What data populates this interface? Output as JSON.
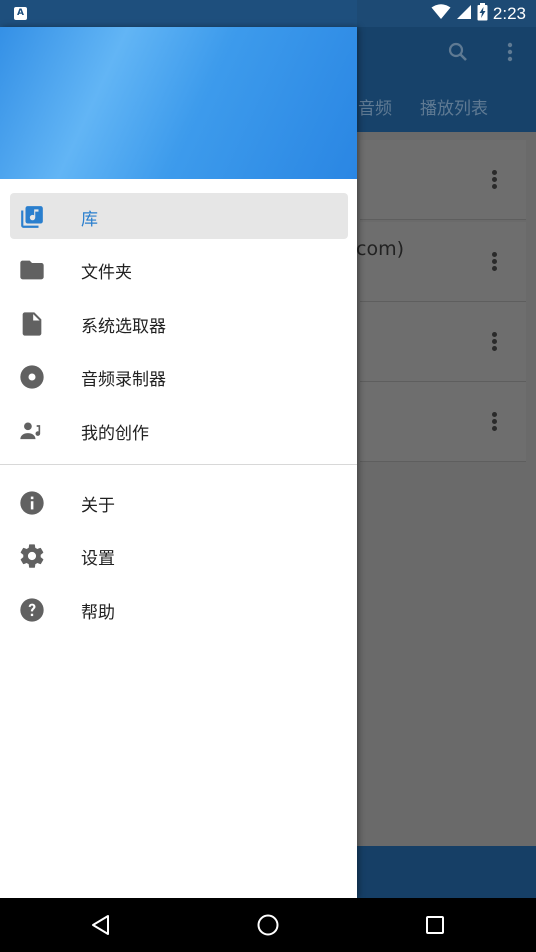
{
  "status_bar": {
    "notification_icon_letter": "A",
    "time": "2:23",
    "icons": [
      "wifi-icon",
      "signal-icon",
      "battery-charging-icon"
    ]
  },
  "background_app": {
    "tabs": [
      "音频",
      "播放列表"
    ],
    "actions": [
      "search-icon",
      "more-vert-icon"
    ],
    "visible_fragment": "com)"
  },
  "drawer": {
    "primary_items": [
      {
        "label": "库",
        "icon": "library-music-icon",
        "selected": true
      },
      {
        "label": "文件夹",
        "icon": "folder-icon",
        "selected": false
      },
      {
        "label": "系统选取器",
        "icon": "file-icon",
        "selected": false
      },
      {
        "label": "音频录制器",
        "icon": "record-disc-icon",
        "selected": false
      },
      {
        "label": "我的创作",
        "icon": "person-music-icon",
        "selected": false
      }
    ],
    "secondary_items": [
      {
        "label": "关于",
        "icon": "info-icon"
      },
      {
        "label": "设置",
        "icon": "settings-gear-icon"
      },
      {
        "label": "帮助",
        "icon": "help-icon"
      }
    ]
  },
  "nav_bar": {
    "buttons": [
      "back-icon",
      "home-icon",
      "recents-icon"
    ]
  },
  "colors": {
    "accent": "#2a7fce",
    "header_gradient_start": "#3490e6",
    "header_gradient_highlight": "#62b5f5",
    "icon_gray": "#616161",
    "app_bar": "#17426a"
  }
}
